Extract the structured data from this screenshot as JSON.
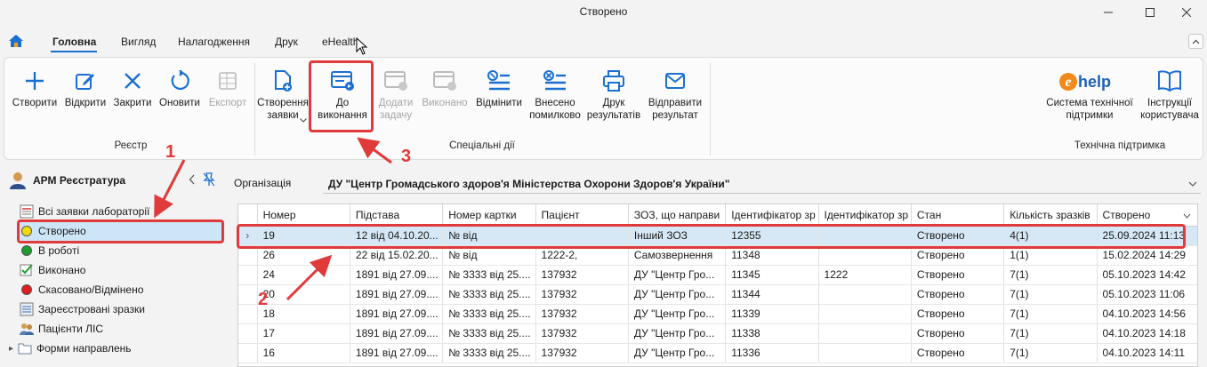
{
  "window": {
    "title": "Створено"
  },
  "menu": {
    "tabs": [
      {
        "label": "Головна"
      },
      {
        "label": "Вигляд"
      },
      {
        "label": "Налагодження"
      },
      {
        "label": "Друк"
      },
      {
        "label": "eHealth"
      }
    ]
  },
  "ribbon": {
    "registry": {
      "group_label": "Реєстр",
      "buttons": [
        {
          "label": "Створити",
          "icon": "plus-icon"
        },
        {
          "label": "Відкрити",
          "icon": "edit-icon"
        },
        {
          "label": "Закрити",
          "icon": "close-icon"
        },
        {
          "label": "Оновити",
          "icon": "refresh-icon"
        },
        {
          "label": "Експорт",
          "icon": "excel-icon",
          "disabled": true
        }
      ]
    },
    "special": {
      "group_label": "Спеціальні дії",
      "buttons": [
        {
          "label": "Створення\nзаявки",
          "icon": "new-request-icon"
        },
        {
          "label": "До\nвиконання",
          "icon": "to-execution-icon"
        },
        {
          "label": "Додати\nзадачу",
          "icon": "add-task-icon",
          "disabled": true
        },
        {
          "label": "Виконано",
          "icon": "done-icon",
          "disabled": true
        },
        {
          "label": "Відмінити",
          "icon": "cancel-list-icon"
        },
        {
          "label": "Внесено\nпомилково",
          "icon": "error-entry-icon"
        },
        {
          "label": "Друк\nрезультатів",
          "icon": "printer-icon"
        },
        {
          "label": "Відправити\nрезультат",
          "icon": "envelope-icon"
        }
      ]
    },
    "support": {
      "group_label": "Технічна підтримка",
      "buttons": [
        {
          "label": "Система технічної\nпідтримки",
          "icon": "ehelp-logo",
          "logo_text": "help"
        },
        {
          "label": "Інструкції\nкористувача",
          "icon": "book-icon"
        }
      ]
    }
  },
  "left_panel": {
    "title": "АРМ Реєстратура",
    "items": [
      {
        "label": "Всі заявки лабораторії",
        "icon": "list-icon"
      },
      {
        "label": "Створено",
        "icon": "yellow-dot-icon",
        "color": "#f5d90a",
        "selected": true
      },
      {
        "label": "В роботі",
        "icon": "green-dot-icon",
        "color": "#1e9c2e"
      },
      {
        "label": "Виконано",
        "icon": "done-check-icon"
      },
      {
        "label": "Скасовано/Відмінено",
        "icon": "red-dot-icon",
        "color": "#e01f1f"
      },
      {
        "label": "Зареєстровані зразки",
        "icon": "samples-icon"
      },
      {
        "label": "Пацієнти ЛІС",
        "icon": "patients-icon"
      },
      {
        "label": "Форми направлень",
        "icon": "folder-icon"
      }
    ]
  },
  "main": {
    "org_label": "Організація",
    "org_value": "ДУ \"Центр Громадського здоров'я Міністерства Охорони Здоров'я України\"",
    "columns": [
      "",
      "Номер",
      "Підстава",
      "Номер картки",
      "Пацієнт",
      "ЗОЗ, що направи",
      "Ідентифікатор зр",
      "Ідентифікатор зр",
      "Стан",
      "Кількість зразків",
      "Створено"
    ],
    "rows": [
      [
        "›",
        "19",
        "12 від 04.10.20...",
        "№  від",
        "",
        "Інший ЗОЗ",
        "12355",
        "",
        "Створено",
        "4(1)",
        "25.09.2024 11:13"
      ],
      [
        "",
        "26",
        "22 від 15.02.20...",
        "№  від",
        "1222-2,",
        "Самозвернення",
        "11348",
        "",
        "Створено",
        "1(1)",
        "15.02.2024 14:29"
      ],
      [
        "",
        "24",
        "1891 від 27.09....",
        "№ 3333 від 25....",
        "137932",
        "ДУ \"Центр Гро...",
        "11345",
        "1222",
        "Створено",
        "7(1)",
        "05.10.2023 14:42"
      ],
      [
        "",
        "20",
        "1891 від 27.09....",
        "№ 3333 від 25....",
        "137932",
        "ДУ \"Центр Гро...",
        "11344",
        "",
        "Створено",
        "7(1)",
        "05.10.2023 11:06"
      ],
      [
        "",
        "18",
        "1891 від 27.09....",
        "№ 3333 від 25....",
        "137932",
        "ДУ \"Центр Гро...",
        "11339",
        "",
        "Створено",
        "7(1)",
        "04.10.2023 14:56"
      ],
      [
        "",
        "17",
        "1891 від 27.09....",
        "№ 3333 від 25....",
        "137932",
        "ДУ \"Центр Гро...",
        "11338",
        "",
        "Створено",
        "7(1)",
        "04.10.2023 14:18"
      ],
      [
        "",
        "16",
        "1891 від 27.09....",
        "№ 3333 від 25....",
        "137932",
        "ДУ \"Центр Гро...",
        "11336",
        "",
        "Створено",
        "7(1)",
        "04.10.2023 14:11"
      ]
    ]
  },
  "annotations": [
    {
      "number": "1"
    },
    {
      "number": "2"
    },
    {
      "number": "3"
    }
  ],
  "colors": {
    "accent": "#1a6fd1",
    "annotation": "#e03a3a",
    "selection": "#d6e8f5"
  }
}
